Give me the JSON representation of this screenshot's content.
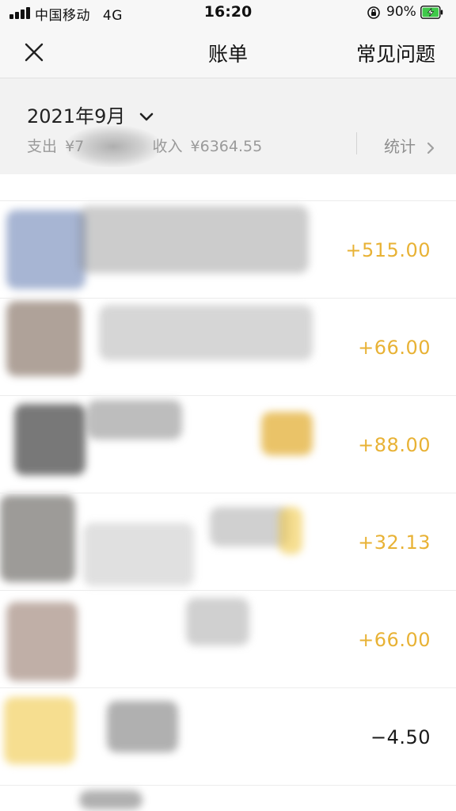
{
  "status_bar": {
    "carrier": "中国移动",
    "network": "4G",
    "time": "16:20",
    "battery_percent": "90%"
  },
  "nav": {
    "title": "账单",
    "faq_label": "常见问题"
  },
  "summary": {
    "month": "2021年9月",
    "expense_label": "支出",
    "expense_value": "¥7",
    "income_label": "收入",
    "income_value": "¥6364.55",
    "stats_label": "统计"
  },
  "transactions": [
    {
      "amount": "+515.00",
      "type": "income"
    },
    {
      "amount": "+66.00",
      "type": "income"
    },
    {
      "amount": "+88.00",
      "type": "income"
    },
    {
      "amount": "+32.13",
      "type": "income"
    },
    {
      "amount": "+66.00",
      "type": "income"
    },
    {
      "amount": "−4.50",
      "type": "expense"
    }
  ],
  "colors": {
    "income": "#e8b235",
    "expense": "#1a1a1a",
    "header_bg": "#f7f7f7",
    "summary_bg": "#f2f2f2",
    "battery_green": "#3fc94a"
  }
}
